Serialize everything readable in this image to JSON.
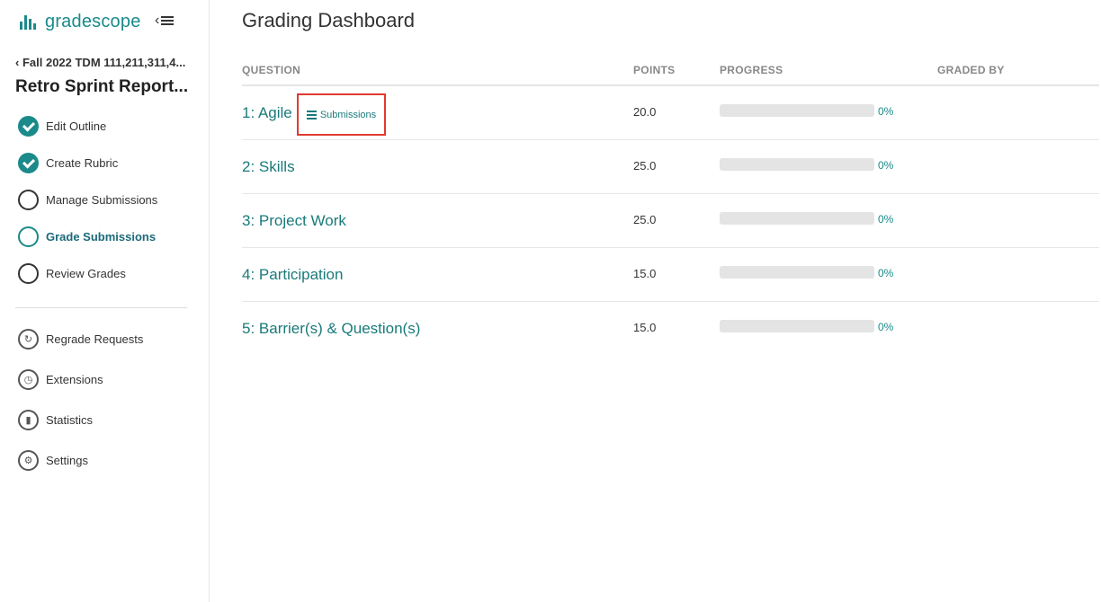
{
  "brand": {
    "name": "gradescope"
  },
  "sidebar": {
    "course": "Fall 2022 TDM 111,211,311,4...",
    "assignment": "Retro Sprint Report...",
    "steps": [
      {
        "label": "Edit Outline",
        "state": "done"
      },
      {
        "label": "Create Rubric",
        "state": "done"
      },
      {
        "label": "Manage Submissions",
        "state": "todo"
      },
      {
        "label": "Grade Submissions",
        "state": "active"
      },
      {
        "label": "Review Grades",
        "state": "todo"
      }
    ],
    "tools": [
      {
        "label": "Regrade Requests",
        "icon": "regrade-icon"
      },
      {
        "label": "Extensions",
        "icon": "clock-icon"
      },
      {
        "label": "Statistics",
        "icon": "statistics-icon"
      },
      {
        "label": "Settings",
        "icon": "gear-icon"
      }
    ]
  },
  "main": {
    "title": "Grading Dashboard",
    "columns": [
      "QUESTION",
      "POINTS",
      "PROGRESS",
      "GRADED BY"
    ],
    "submissions_label": "Submissions",
    "questions": [
      {
        "label": "1: Agile",
        "points": "20.0",
        "progress": 0,
        "progress_text": "0%"
      },
      {
        "label": "2: Skills",
        "points": "25.0",
        "progress": 0,
        "progress_text": "0%"
      },
      {
        "label": "3: Project Work",
        "points": "25.0",
        "progress": 0,
        "progress_text": "0%"
      },
      {
        "label": "4: Participation",
        "points": "15.0",
        "progress": 0,
        "progress_text": "0%"
      },
      {
        "label": "5: Barrier(s) & Question(s)",
        "points": "15.0",
        "progress": 0,
        "progress_text": "0%"
      }
    ]
  },
  "colors": {
    "accent": "#1a8a8a",
    "highlight": "#e03a2f"
  }
}
